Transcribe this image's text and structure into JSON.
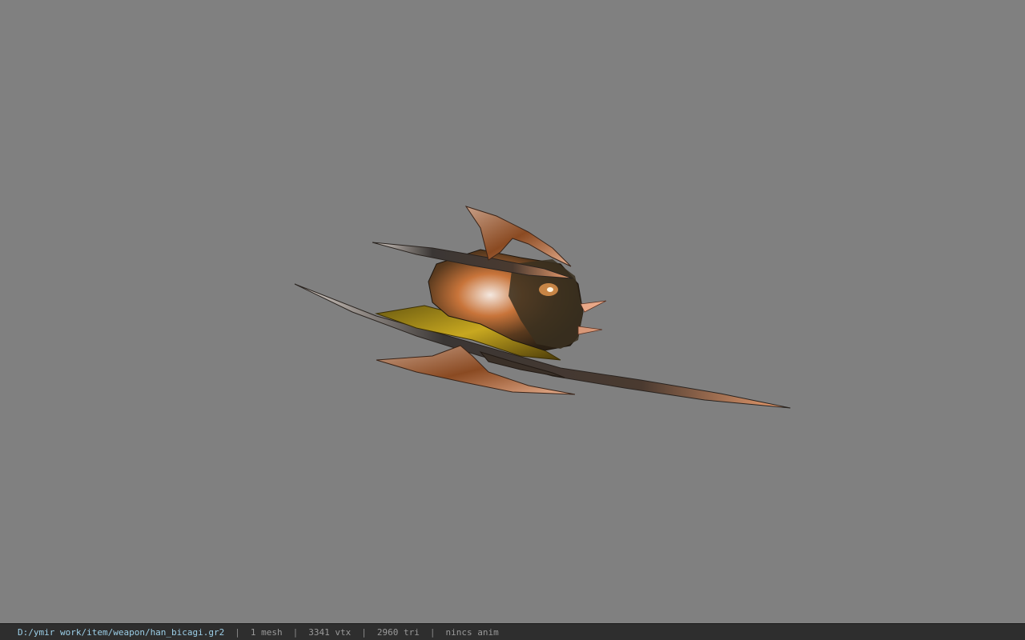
{
  "status": {
    "file_path": "D:/ymir work/item/weapon/han_bicagi.gr2",
    "separator": "|",
    "mesh_count": "1 mesh",
    "vertex_count": "3341 vtx",
    "triangle_count": "2960 tri",
    "animation": "nincs anim"
  },
  "colors": {
    "viewport_background": "#808080",
    "status_bar_background": "#2e2e2e",
    "path_text": "#9ccfe8",
    "status_text": "#9a9a9a"
  },
  "model": {
    "icon": "dagger-claw-weapon-model"
  }
}
